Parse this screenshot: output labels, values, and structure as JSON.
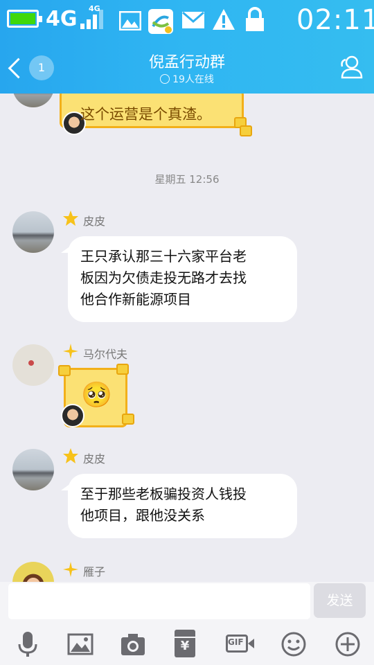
{
  "status_bar": {
    "network": "4G",
    "signal_label": "4G",
    "time": "02:11",
    "battery_color": "#3fd80c",
    "icons": [
      "battery-icon",
      "signal-icon",
      "image-icon",
      "china-mobile-icon",
      "mail-icon",
      "warning-icon",
      "lock-icon"
    ]
  },
  "header": {
    "title": "倪孟行动群",
    "online": "19人在线",
    "unread_count": "1",
    "accent": "#2fb5f2"
  },
  "chat": {
    "top_bubble_text": "这个运营是个真渣。",
    "timestamp": "星期五 12:56",
    "messages": [
      {
        "sender": "皮皮",
        "text_lines": [
          "王只承认那三十六家平台老",
          "板因为欠债走投无路才去找",
          "他合作新能源项目"
        ]
      },
      {
        "sender": "马尔代夫",
        "emoji": "🥺"
      },
      {
        "sender": "皮皮",
        "text_lines": [
          "至于那些老板骗投资人钱投",
          "他项目，跟他没关系"
        ]
      },
      {
        "sender": "雁子"
      }
    ]
  },
  "input": {
    "placeholder": "",
    "send_label": "发送"
  },
  "toolbar": {
    "icons": [
      "microphone-icon",
      "image-icon",
      "camera-icon",
      "red-packet-icon",
      "gif-icon",
      "emoji-icon",
      "plus-icon"
    ],
    "gif_label": "GIF",
    "yen_label": "¥"
  }
}
